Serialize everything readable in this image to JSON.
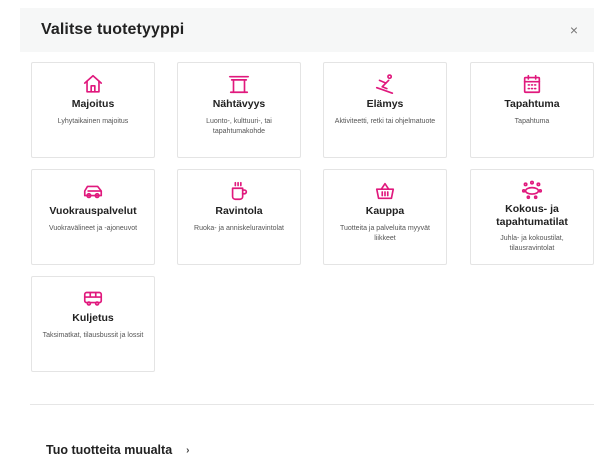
{
  "modal": {
    "title": "Valitse tuotetyyppi",
    "close_label": "×"
  },
  "accent_color": "#e0197d",
  "product_types": [
    {
      "icon": "house-icon",
      "title": "Majoitus",
      "desc": "Lyhytaikainen majoitus"
    },
    {
      "icon": "gate-icon",
      "title": "Nähtävyys",
      "desc": "Luonto-, kulttuuri-, tai tapahtumakohde"
    },
    {
      "icon": "skier-icon",
      "title": "Elämys",
      "desc": "Aktiviteetti, retki tai ohjelmatuote"
    },
    {
      "icon": "calendar-icon",
      "title": "Tapahtuma",
      "desc": "Tapahtuma"
    },
    {
      "icon": "car-icon",
      "title": "Vuokrauspalvelut",
      "desc": "Vuokravälineet ja -ajoneuvot"
    },
    {
      "icon": "cup-icon",
      "title": "Ravintola",
      "desc": "Ruoka- ja anniskeluravintolat"
    },
    {
      "icon": "basket-icon",
      "title": "Kauppa",
      "desc": "Tuotteita ja palveluita myyvät liikkeet"
    },
    {
      "icon": "conference-icon",
      "title": "Kokous- ja tapahtumatilat",
      "desc": "Juhla- ja kokoustilat, tilausravintolat"
    },
    {
      "icon": "bus-icon",
      "title": "Kuljetus",
      "desc": "Taksimatkat, tilausbussit ja lossit"
    }
  ],
  "import_link": {
    "label": "Tuo tuotteita muualta",
    "chevron": "›"
  }
}
